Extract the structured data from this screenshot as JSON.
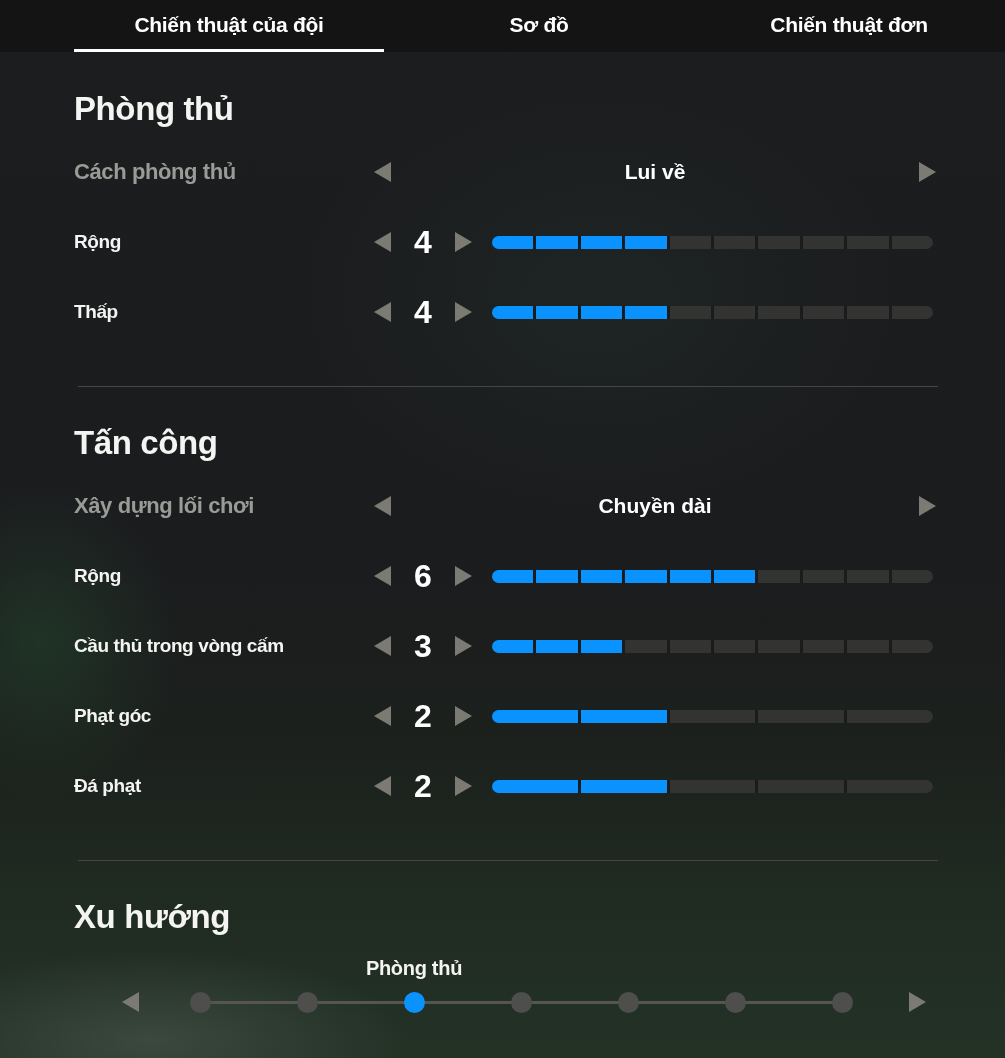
{
  "tabs": [
    {
      "label": "Chiến thuật của đội",
      "selected": true
    },
    {
      "label": "Sơ đồ",
      "selected": false
    },
    {
      "label": "Chiến thuật đơn",
      "selected": false
    }
  ],
  "sections": [
    {
      "title": "Phòng thủ",
      "rows": [
        {
          "kind": "select",
          "label": "Cách phòng thủ",
          "value": "Lui về"
        },
        {
          "kind": "slider",
          "label": "Rộng",
          "value": "4",
          "segments": [
            {
              "filled": true
            },
            {
              "filled": true
            },
            {
              "filled": true
            },
            {
              "filled": true
            },
            {
              "filled": false
            },
            {
              "filled": false
            },
            {
              "filled": false
            },
            {
              "filled": false
            },
            {
              "filled": false
            },
            {
              "filled": false
            }
          ]
        },
        {
          "kind": "slider",
          "label": "Thấp",
          "value": "4",
          "segments": [
            {
              "filled": true
            },
            {
              "filled": true
            },
            {
              "filled": true
            },
            {
              "filled": true
            },
            {
              "filled": false
            },
            {
              "filled": false
            },
            {
              "filled": false
            },
            {
              "filled": false
            },
            {
              "filled": false
            },
            {
              "filled": false
            }
          ]
        }
      ]
    },
    {
      "title": "Tấn công",
      "rows": [
        {
          "kind": "select",
          "label": "Xây dựng lối chơi",
          "value": "Chuyền dài"
        },
        {
          "kind": "slider",
          "label": "Rộng",
          "value": "6",
          "segments": [
            {
              "filled": true
            },
            {
              "filled": true
            },
            {
              "filled": true
            },
            {
              "filled": true
            },
            {
              "filled": true
            },
            {
              "filled": true
            },
            {
              "filled": false
            },
            {
              "filled": false
            },
            {
              "filled": false
            },
            {
              "filled": false
            }
          ]
        },
        {
          "kind": "slider",
          "label": "Cầu thủ trong vòng cấm",
          "value": "3",
          "segments": [
            {
              "filled": true
            },
            {
              "filled": true
            },
            {
              "filled": true
            },
            {
              "filled": false
            },
            {
              "filled": false
            },
            {
              "filled": false
            },
            {
              "filled": false
            },
            {
              "filled": false
            },
            {
              "filled": false
            },
            {
              "filled": false
            }
          ]
        },
        {
          "kind": "slider",
          "label": "Phạt góc",
          "value": "2",
          "segments": [
            {
              "filled": true
            },
            {
              "filled": true
            },
            {
              "filled": false
            },
            {
              "filled": false
            },
            {
              "filled": false
            }
          ]
        },
        {
          "kind": "slider",
          "label": "Đá phạt",
          "value": "2",
          "segments": [
            {
              "filled": true
            },
            {
              "filled": true
            },
            {
              "filled": false
            },
            {
              "filled": false
            },
            {
              "filled": false
            }
          ]
        }
      ]
    }
  ],
  "tendency": {
    "title": "Xu hướng",
    "label": "Phòng thủ",
    "steps": [
      {
        "selected": false
      },
      {
        "selected": false
      },
      {
        "selected": true
      },
      {
        "selected": false
      },
      {
        "selected": false
      },
      {
        "selected": false
      },
      {
        "selected": false
      }
    ]
  }
}
